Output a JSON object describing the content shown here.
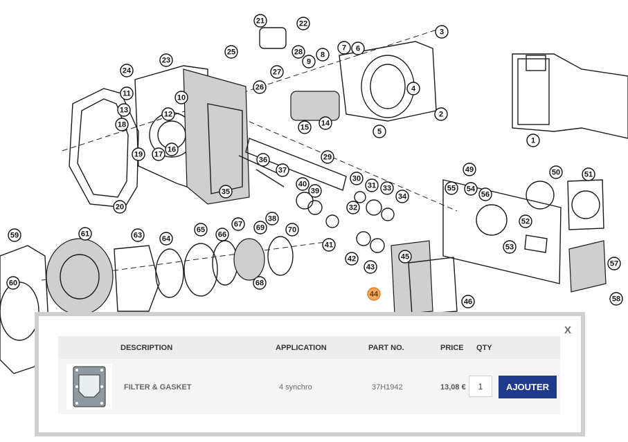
{
  "diagram": {
    "callouts": [
      "1",
      "2",
      "3",
      "4",
      "5",
      "6",
      "7",
      "8",
      "9",
      "10",
      "11",
      "12",
      "13",
      "14",
      "15",
      "16",
      "17",
      "18",
      "19",
      "20",
      "21",
      "22",
      "23",
      "24",
      "25",
      "26",
      "27",
      "28",
      "29",
      "30",
      "31",
      "32",
      "33",
      "34",
      "35",
      "36",
      "37",
      "38",
      "39",
      "40",
      "41",
      "42",
      "43",
      "44",
      "45",
      "46",
      "49",
      "50",
      "51",
      "52",
      "53",
      "54",
      "55",
      "56",
      "57",
      "58",
      "59",
      "60",
      "61",
      "63",
      "64",
      "65",
      "66",
      "67",
      "68",
      "69",
      "70"
    ],
    "highlighted_callout": "44",
    "highlight_color": "#f4a85a"
  },
  "popup": {
    "close_label": "X",
    "headers": {
      "description": "DESCRIPTION",
      "application": "APPLICATION",
      "part_no": "PART NO.",
      "price": "PRICE",
      "qty": "QTY"
    },
    "item": {
      "thumbnail_icon": "gasket-thumbnail-icon",
      "description": "FILTER & GASKET",
      "application": "4 synchro",
      "part_no": "37H1942",
      "price": "13,08 €",
      "qty": "1"
    },
    "add_label": "AJOUTER",
    "accent_color": "#1f3a8a"
  }
}
